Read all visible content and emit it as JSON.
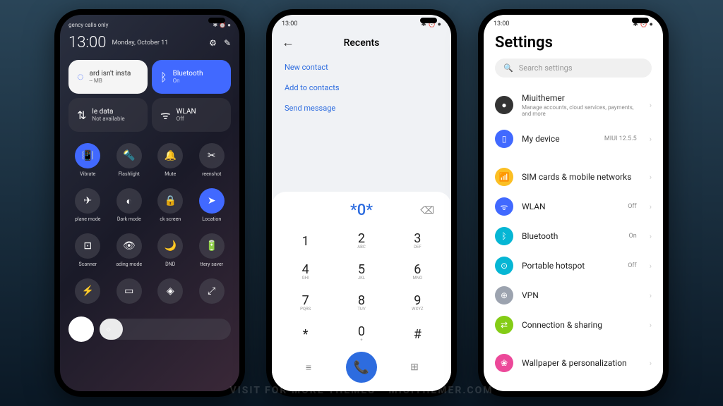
{
  "watermark": "VISIT FOR MORE THEMES - MIUITHEMER.COM",
  "phone1": {
    "status_left": "gency calls only",
    "status_right": "✱ ⏰ ●",
    "time": "13:00",
    "date": "Monday, October 11",
    "tiles": {
      "data_card": {
        "title": "ard isn't insta",
        "sub": "-- MB"
      },
      "bluetooth": {
        "title": "Bluetooth",
        "sub": "On"
      },
      "mobile_data": {
        "title": "le data",
        "sub": "Not available"
      },
      "wlan": {
        "title": "WLAN",
        "sub": "Off"
      }
    },
    "toggles": [
      {
        "label": "Vibrate",
        "active": true
      },
      {
        "label": "Flashlight",
        "active": false
      },
      {
        "label": "Mute",
        "active": false
      },
      {
        "label": "reenshot",
        "active": false
      },
      {
        "label": "plane mode",
        "active": false
      },
      {
        "label": "Dark mode",
        "active": false
      },
      {
        "label": "ck screen",
        "active": false
      },
      {
        "label": "Location",
        "active": true
      },
      {
        "label": "Scanner",
        "active": false
      },
      {
        "label": "ading mode",
        "active": false
      },
      {
        "label": "DND",
        "active": false
      },
      {
        "label": "ttery saver",
        "active": false
      },
      {
        "label": "",
        "active": false
      },
      {
        "label": "",
        "active": false
      },
      {
        "label": "",
        "active": false
      },
      {
        "label": "",
        "active": false
      }
    ]
  },
  "phone2": {
    "time": "13:00",
    "status_right": "✱ ⏰ ●",
    "title": "Recents",
    "links": [
      "New contact",
      "Add to contacts",
      "Send message"
    ],
    "entered": "*0*",
    "keys": [
      {
        "n": "1",
        "l": ""
      },
      {
        "n": "2",
        "l": "ABC"
      },
      {
        "n": "3",
        "l": "DEF"
      },
      {
        "n": "4",
        "l": "GHI"
      },
      {
        "n": "5",
        "l": "JKL"
      },
      {
        "n": "6",
        "l": "MNO"
      },
      {
        "n": "7",
        "l": "PQRS"
      },
      {
        "n": "8",
        "l": "TUV"
      },
      {
        "n": "9",
        "l": "WXYZ"
      },
      {
        "n": "*",
        "l": ""
      },
      {
        "n": "0",
        "l": "+"
      },
      {
        "n": "#",
        "l": ""
      }
    ]
  },
  "phone3": {
    "time": "13:00",
    "status_right": "✱ ⏰ ●",
    "title": "Settings",
    "search_placeholder": "Search settings",
    "account": {
      "title": "Miuithemer",
      "sub": "Manage accounts, cloud services, payments, and more"
    },
    "my_device": {
      "title": "My device",
      "value": "MIUI 12.5.5"
    },
    "items": [
      {
        "title": "SIM cards & mobile networks",
        "icon": "yellow",
        "glyph": "📶",
        "value": ""
      },
      {
        "title": "WLAN",
        "icon": "blue",
        "glyph": "ᯤ",
        "value": "Off"
      },
      {
        "title": "Bluetooth",
        "icon": "cyan",
        "glyph": "ᛒ",
        "value": "On"
      },
      {
        "title": "Portable hotspot",
        "icon": "cyan",
        "glyph": "⊙",
        "value": "Off"
      },
      {
        "title": "VPN",
        "icon": "gray",
        "glyph": "⊕",
        "value": ""
      },
      {
        "title": "Connection & sharing",
        "icon": "green",
        "glyph": "⇄",
        "value": ""
      }
    ],
    "wallpaper": {
      "title": "Wallpaper & personalization"
    }
  }
}
